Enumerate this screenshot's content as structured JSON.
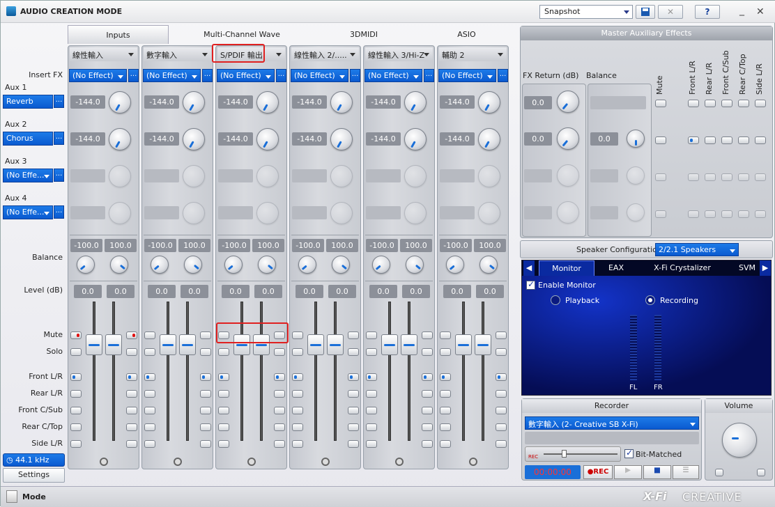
{
  "titlebar": {
    "title": "AUDIO CREATION MODE",
    "snapshot": "Snapshot",
    "help": "?",
    "minimize": "_",
    "close": "✕"
  },
  "tabs": [
    "Inputs",
    "Multi-Channel Wave",
    "3DMIDI",
    "ASIO"
  ],
  "row_labels": {
    "insert_fx": "Insert FX",
    "balance": "Balance",
    "level": "Level (dB)",
    "mute": "Mute",
    "solo": "Solo",
    "front": "Front L/R",
    "rear": "Rear L/R",
    "frontc": "Front C/Sub",
    "rearc": "Rear C/Top",
    "side": "Side L/R"
  },
  "aux": [
    {
      "label": "Aux 1",
      "value": "Reverb"
    },
    {
      "label": "Aux 2",
      "value": "Chorus"
    },
    {
      "label": "Aux 3",
      "value": "(No Effe..."
    },
    {
      "label": "Aux 4",
      "value": "(No Effe..."
    }
  ],
  "strips": [
    {
      "name": "線性輸入",
      "fx": "(No Effect)",
      "aux1": "-144.0",
      "aux2": "-144.0",
      "bal_l": "-100.0",
      "bal_r": "100.0",
      "lvl_l": "0.0",
      "lvl_r": "0.0"
    },
    {
      "name": "數字輸入",
      "fx": "(No Effect)",
      "aux1": "-144.0",
      "aux2": "-144.0",
      "bal_l": "-100.0",
      "bal_r": "100.0",
      "lvl_l": "0.0",
      "lvl_r": "0.0"
    },
    {
      "name": "S/PDIF 輸出",
      "fx": "(No Effect)",
      "aux1": "-144.0",
      "aux2": "-144.0",
      "bal_l": "-100.0",
      "bal_r": "100.0",
      "lvl_l": "0.0",
      "lvl_r": "0.0"
    },
    {
      "name": "線性輸入 2/.....",
      "fx": "(No Effect)",
      "aux1": "-144.0",
      "aux2": "-144.0",
      "bal_l": "-100.0",
      "bal_r": "100.0",
      "lvl_l": "0.0",
      "lvl_r": "0.0"
    },
    {
      "name": "線性輸入 3/Hi-Z",
      "fx": "(No Effect)",
      "aux1": "-144.0",
      "aux2": "-144.0",
      "bal_l": "-100.0",
      "bal_r": "100.0",
      "lvl_l": "0.0",
      "lvl_r": "0.0"
    },
    {
      "name": "輔助 2",
      "fx": "(No Effect)",
      "aux1": "-144.0",
      "aux2": "-144.0",
      "bal_l": "-100.0",
      "bal_r": "100.0",
      "lvl_l": "0.0",
      "lvl_r": "0.0"
    }
  ],
  "dots": "...",
  "sample_rate": "44.1 kHz",
  "settings": "Settings",
  "master": {
    "title": "Master Auxiliary Effects",
    "fx_return": "FX Return (dB)",
    "balance": "Balance",
    "ret1": "0.0",
    "ret2": "0.0",
    "bal": "0.0",
    "cols": [
      "Mute",
      "Front L/R",
      "Rear L/R",
      "Front C/Sub",
      "Rear C/Top",
      "Side L/R"
    ]
  },
  "speaker": {
    "label": "Speaker Configuration:",
    "value": "2/2.1 Speakers"
  },
  "monitor": {
    "tabs": [
      "Monitor",
      "EAX",
      "X-Fi Crystalizer",
      "SVM"
    ],
    "enable": "Enable Monitor",
    "playback": "Playback",
    "recording": "Recording",
    "fl": "FL",
    "fr": "FR"
  },
  "recorder": {
    "title": "Recorder",
    "source": "數字輸入 (2- Creative SB X-Fi)",
    "time": "00:00:00",
    "rec": "●REC",
    "bitmatched": "Bit-Matched",
    "rec_small": "REC"
  },
  "volume": {
    "title": "Volume"
  },
  "bottom": {
    "mode": "Mode",
    "brand": "CREATIVE",
    "xfi": "X-Fi"
  }
}
